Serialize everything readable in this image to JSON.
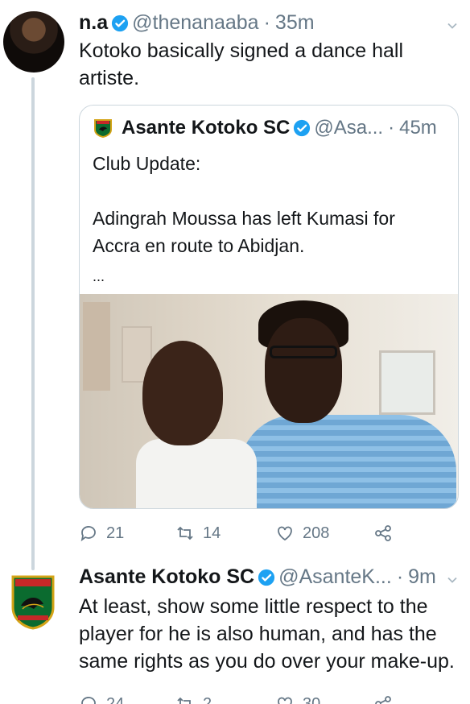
{
  "tweet1": {
    "display_name": "n.a",
    "handle": "@thenanaaba",
    "time": "35m",
    "text_lines": [
      "Kotoko basically signed a dance hall",
      "artiste."
    ],
    "quoted": {
      "display_name": "Asante Kotoko SC",
      "handle": "@Asa...",
      "time": "45m",
      "lines": [
        "Club Update:",
        "Adingrah Moussa has left Kumasi for",
        "Accra en route to Abidjan.",
        "..."
      ]
    },
    "actions": {
      "replies": "21",
      "retweets": "14",
      "likes": "208"
    }
  },
  "tweet2": {
    "display_name": "Asante Kotoko SC",
    "handle": "@AsanteK...",
    "time": "9m",
    "text_lines": [
      "At least, show some little respect to the",
      "player for he is also human, and has the",
      "same rights as you do over your make-up."
    ],
    "actions": {
      "replies": "24",
      "retweets": "2",
      "likes": "30"
    }
  },
  "separator": "·",
  "colors": {
    "verified": "#1da1f2",
    "meta": "#657786",
    "text": "#14171a",
    "border": "#ccd6dd"
  },
  "icons": [
    "verified-badge-icon",
    "chevron-down-icon",
    "reply-icon",
    "retweet-icon",
    "like-icon",
    "share-icon",
    "kotoko-logo"
  ]
}
